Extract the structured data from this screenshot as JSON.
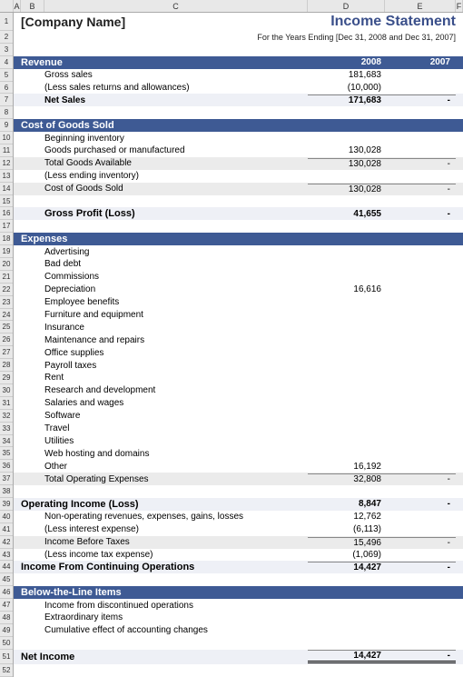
{
  "cols": [
    "A",
    "B",
    "C",
    "D",
    "E",
    "F"
  ],
  "header": {
    "company": "[Company Name]",
    "title": "Income Statement",
    "subtitle": "For the Years Ending [Dec 31, 2008 and Dec 31, 2007]"
  },
  "sections": {
    "revenue": {
      "title": "Revenue",
      "y1": "2008",
      "y2": "2007",
      "rows": [
        {
          "label": "Gross sales",
          "d": "181,683",
          "e": ""
        },
        {
          "label": "(Less sales returns and allowances)",
          "d": "(10,000)",
          "e": ""
        }
      ],
      "net": {
        "label": "Net Sales",
        "d": "171,683",
        "e": "-"
      }
    },
    "cogs": {
      "title": "Cost of Goods Sold",
      "rows": [
        {
          "label": "Beginning inventory",
          "d": "",
          "e": ""
        },
        {
          "label": "Goods purchased or manufactured",
          "d": "130,028",
          "e": ""
        },
        {
          "label": "Total Goods Available",
          "d": "130,028",
          "e": "-"
        },
        {
          "label": "(Less ending inventory)",
          "d": "",
          "e": ""
        },
        {
          "label": "Cost of Goods Sold",
          "d": "130,028",
          "e": "-"
        }
      ],
      "gp": {
        "label": "Gross Profit (Loss)",
        "d": "41,655",
        "e": "-"
      }
    },
    "expenses": {
      "title": "Expenses",
      "rows": [
        {
          "label": "Advertising",
          "d": "",
          "e": ""
        },
        {
          "label": "Bad debt",
          "d": "",
          "e": ""
        },
        {
          "label": "Commissions",
          "d": "",
          "e": ""
        },
        {
          "label": "Depreciation",
          "d": "16,616",
          "e": ""
        },
        {
          "label": "Employee benefits",
          "d": "",
          "e": ""
        },
        {
          "label": "Furniture and equipment",
          "d": "",
          "e": ""
        },
        {
          "label": "Insurance",
          "d": "",
          "e": ""
        },
        {
          "label": "Maintenance and repairs",
          "d": "",
          "e": ""
        },
        {
          "label": "Office supplies",
          "d": "",
          "e": ""
        },
        {
          "label": "Payroll taxes",
          "d": "",
          "e": ""
        },
        {
          "label": "Rent",
          "d": "",
          "e": ""
        },
        {
          "label": "Research and development",
          "d": "",
          "e": ""
        },
        {
          "label": "Salaries and wages",
          "d": "",
          "e": ""
        },
        {
          "label": "Software",
          "d": "",
          "e": ""
        },
        {
          "label": "Travel",
          "d": "",
          "e": ""
        },
        {
          "label": "Utilities",
          "d": "",
          "e": ""
        },
        {
          "label": "Web hosting and domains",
          "d": "",
          "e": ""
        },
        {
          "label": "Other",
          "d": "16,192",
          "e": ""
        }
      ],
      "total": {
        "label": "Total Operating Expenses",
        "d": "32,808",
        "e": "-"
      }
    },
    "operating": {
      "title": {
        "label": "Operating Income (Loss)",
        "d": "8,847",
        "e": "-"
      },
      "rows": [
        {
          "label": "Non-operating revenues, expenses, gains, losses",
          "d": "12,762",
          "e": ""
        },
        {
          "label": "(Less interest expense)",
          "d": "(6,113)",
          "e": ""
        },
        {
          "label": "Income Before Taxes",
          "d": "15,496",
          "e": "-"
        },
        {
          "label": "(Less income tax expense)",
          "d": "(1,069)",
          "e": ""
        }
      ],
      "cont": {
        "label": "Income From Continuing Operations",
        "d": "14,427",
        "e": "-"
      }
    },
    "below": {
      "title": "Below-the-Line Items",
      "rows": [
        {
          "label": "Income from discontinued operations",
          "d": "",
          "e": ""
        },
        {
          "label": "Extraordinary items",
          "d": "",
          "e": ""
        },
        {
          "label": "Cumulative effect of accounting changes",
          "d": "",
          "e": ""
        }
      ]
    },
    "netincome": {
      "label": "Net Income",
      "d": "14,427",
      "e": "-"
    }
  }
}
